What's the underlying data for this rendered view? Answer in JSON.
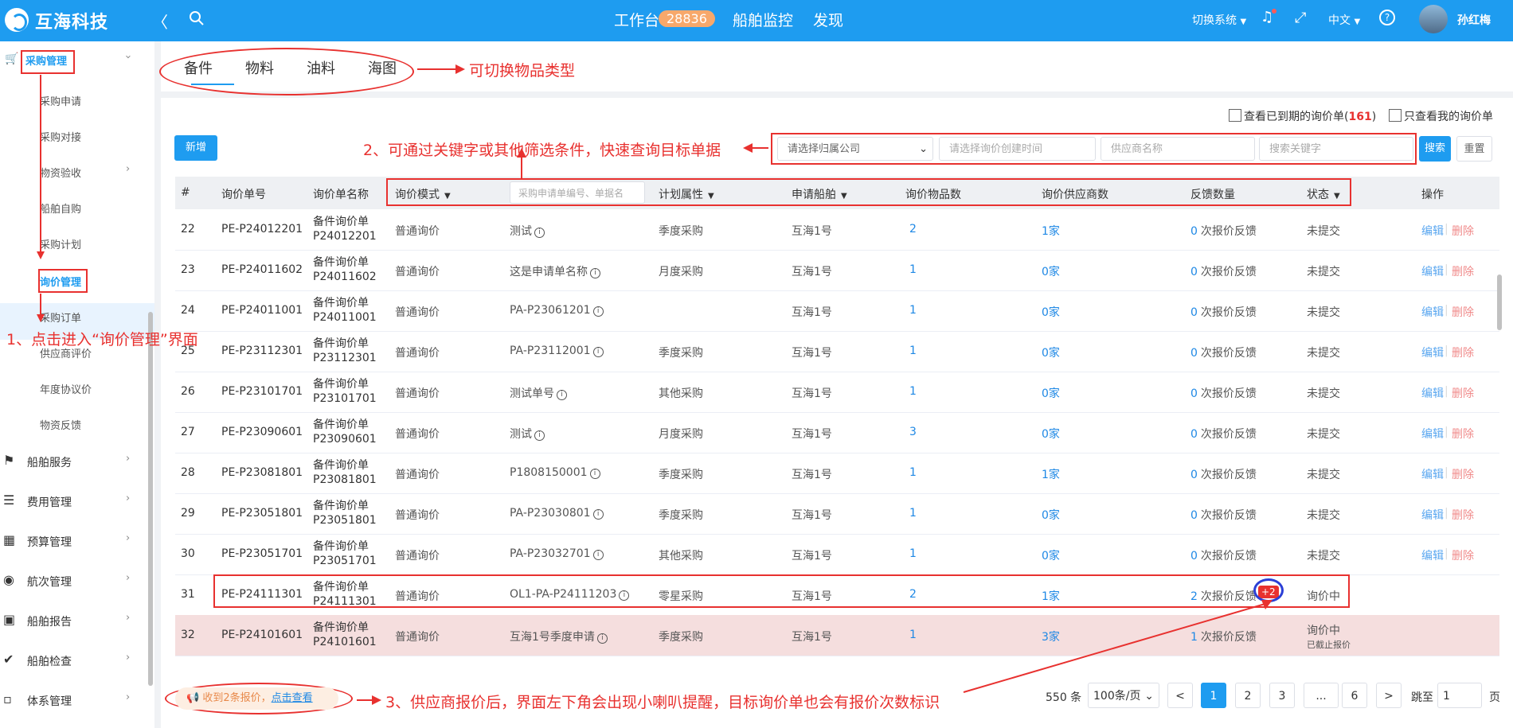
{
  "header": {
    "brand": "互海科技",
    "nav": [
      {
        "label": "工作台"
      },
      {
        "label": "船舶监控"
      },
      {
        "label": "发现"
      }
    ],
    "workbench_badge": "28836",
    "switch_system": "切换系统",
    "language": "中文",
    "user_name": "孙红梅"
  },
  "sidebar": {
    "group_active": "采购管理",
    "sub_items": [
      "采购申请",
      "采购对接",
      "物资验收",
      "船舶自购",
      "采购计划",
      "询价管理",
      "采购订单",
      "供应商评价",
      "年度协议价",
      "物资反馈"
    ],
    "groups": [
      "船舶服务",
      "费用管理",
      "预算管理",
      "航次管理",
      "船舶报告",
      "船舶检查",
      "体系管理"
    ]
  },
  "tabs": [
    "备件",
    "物料",
    "油料",
    "海图"
  ],
  "filters": {
    "expired_label": "查看已到期的询价单(",
    "expired_count": "161",
    "expired_close": ")",
    "mine_label": "只查看我的询价单",
    "new_button": "新增",
    "company_placeholder": "请选择归属公司",
    "date_placeholder": "请选择询价创建时间",
    "supplier_placeholder": "供应商名称",
    "keyword_placeholder": "搜索关键字",
    "search_button": "搜索",
    "reset_button": "重置",
    "header_search_placeholder": "采购申请单编号、单据名"
  },
  "table": {
    "headers": {
      "index": "#",
      "code": "询价单号",
      "name": "询价单名称",
      "mode": "询价模式",
      "plan": "计划属性",
      "vessel": "申请船舶",
      "item_count": "询价物品数",
      "supplier_count": "询价供应商数",
      "feedback": "反馈数量",
      "status": "状态",
      "ops": "操作"
    },
    "rows": [
      {
        "idx": "22",
        "code": "PE-P24012201",
        "name": "备件询价单P24012201",
        "mode": "普通询价",
        "req": "测试",
        "plan": "季度采购",
        "vessel": "互海1号",
        "items": "2",
        "suppliers": "1家",
        "fb_num": "0",
        "fb_text": "次报价反馈",
        "status": "未提交",
        "edit": "编辑",
        "del": "删除"
      },
      {
        "idx": "23",
        "code": "PE-P24011602",
        "name": "备件询价单P24011602",
        "mode": "普通询价",
        "req": "这是申请单名称",
        "plan": "月度采购",
        "vessel": "互海1号",
        "items": "1",
        "suppliers": "0家",
        "fb_num": "0",
        "fb_text": "次报价反馈",
        "status": "未提交",
        "edit": "编辑",
        "del": "删除"
      },
      {
        "idx": "24",
        "code": "PE-P24011001",
        "name": "备件询价单P24011001",
        "mode": "普通询价",
        "req": "PA-P23061201",
        "plan": "",
        "vessel": "互海1号",
        "items": "1",
        "suppliers": "0家",
        "fb_num": "0",
        "fb_text": "次报价反馈",
        "status": "未提交",
        "edit": "编辑",
        "del": "删除"
      },
      {
        "idx": "25",
        "code": "PE-P23112301",
        "name": "备件询价单P23112301",
        "mode": "普通询价",
        "req": "PA-P23112001",
        "plan": "季度采购",
        "vessel": "互海1号",
        "items": "1",
        "suppliers": "0家",
        "fb_num": "0",
        "fb_text": "次报价反馈",
        "status": "未提交",
        "edit": "编辑",
        "del": "删除"
      },
      {
        "idx": "26",
        "code": "PE-P23101701",
        "name": "备件询价单P23101701",
        "mode": "普通询价",
        "req": "测试单号",
        "plan": "其他采购",
        "vessel": "互海1号",
        "items": "1",
        "suppliers": "0家",
        "fb_num": "0",
        "fb_text": "次报价反馈",
        "status": "未提交",
        "edit": "编辑",
        "del": "删除"
      },
      {
        "idx": "27",
        "code": "PE-P23090601",
        "name": "备件询价单P23090601",
        "mode": "普通询价",
        "req": "测试",
        "plan": "月度采购",
        "vessel": "互海1号",
        "items": "3",
        "suppliers": "0家",
        "fb_num": "0",
        "fb_text": "次报价反馈",
        "status": "未提交",
        "edit": "编辑",
        "del": "删除"
      },
      {
        "idx": "28",
        "code": "PE-P23081801",
        "name": "备件询价单P23081801",
        "mode": "普通询价",
        "req": "P1808150001",
        "plan": "季度采购",
        "vessel": "互海1号",
        "items": "1",
        "suppliers": "1家",
        "fb_num": "0",
        "fb_text": "次报价反馈",
        "status": "未提交",
        "edit": "编辑",
        "del": "删除"
      },
      {
        "idx": "29",
        "code": "PE-P23051801",
        "name": "备件询价单P23051801",
        "mode": "普通询价",
        "req": "PA-P23030801",
        "plan": "季度采购",
        "vessel": "互海1号",
        "items": "1",
        "suppliers": "0家",
        "fb_num": "0",
        "fb_text": "次报价反馈",
        "status": "未提交",
        "edit": "编辑",
        "del": "删除"
      },
      {
        "idx": "30",
        "code": "PE-P23051701",
        "name": "备件询价单P23051701",
        "mode": "普通询价",
        "req": "PA-P23032701",
        "plan": "其他采购",
        "vessel": "互海1号",
        "items": "1",
        "suppliers": "0家",
        "fb_num": "0",
        "fb_text": "次报价反馈",
        "status": "未提交",
        "edit": "编辑",
        "del": "删除"
      },
      {
        "idx": "31",
        "code": "PE-P24111301",
        "name": "备件询价单P24111301",
        "mode": "普通询价",
        "req": "OL1-PA-P24111203",
        "plan": "零星采购",
        "vessel": "互海1号",
        "items": "2",
        "suppliers": "1家",
        "fb_num": "2",
        "fb_text": "次报价反馈",
        "status": "询价中",
        "badge": "+2"
      },
      {
        "idx": "32",
        "code": "PE-P24101601",
        "name": "备件询价单P24101601",
        "mode": "普通询价",
        "req": "互海1号季度申请",
        "plan": "季度采购",
        "vessel": "互海1号",
        "items": "1",
        "suppliers": "3家",
        "fb_num": "1",
        "fb_text": "次报价反馈",
        "status": "询价中",
        "status_sub": "已截止报价"
      }
    ]
  },
  "notification": {
    "text": "收到2条报价，",
    "link": "点击查看"
  },
  "pagination": {
    "total": "550 条",
    "page_size": "100条/页",
    "pages": [
      "1",
      "2",
      "3",
      "...",
      "6"
    ],
    "current": "1",
    "jump_label": "跳至",
    "jump_value": "1",
    "page_suffix": "页"
  },
  "annotations": {
    "a1": "1、点击进入“询价管理”界面",
    "a2": "2、可通过关键字或其他筛选条件，快速查询目标单据",
    "a3": "3、供应商报价后，界面左下角会出现小喇叭提醒，目标询价单也会有报价次数标识",
    "tabs_note": "可切换物品类型"
  },
  "colors": {
    "primary": "#1e9cf0",
    "annotation": "#e8312f",
    "badge_red": "#e8312f"
  }
}
